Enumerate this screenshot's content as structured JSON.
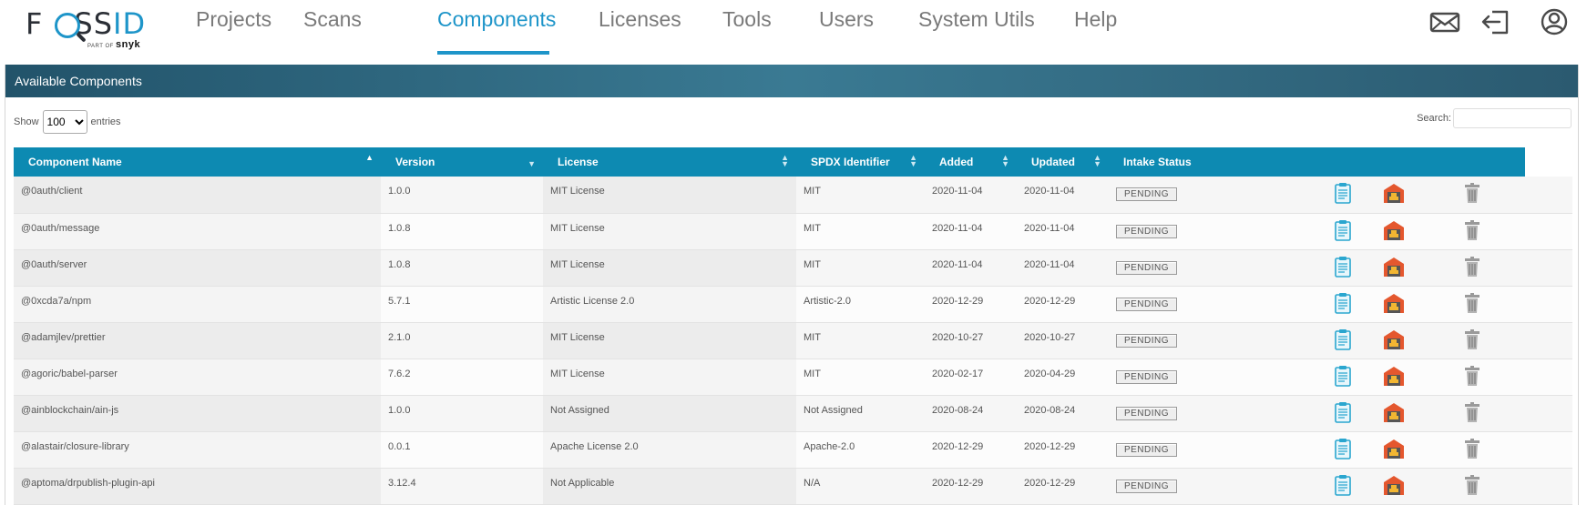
{
  "brand": {
    "logo_main": "F",
    "logo_mid": "SS",
    "logo_id": "ID",
    "part_of": "PART OF",
    "parent": "snyk"
  },
  "nav": [
    {
      "label": "Projects",
      "active": false
    },
    {
      "label": "Scans",
      "active": false
    },
    {
      "label": "Components",
      "active": true
    },
    {
      "label": "Licenses",
      "active": false
    },
    {
      "label": "Tools",
      "active": false
    },
    {
      "label": "Users",
      "active": false
    },
    {
      "label": "System Utils",
      "active": false
    },
    {
      "label": "Help",
      "active": false
    }
  ],
  "top_icons": [
    "mail-icon",
    "logout-icon",
    "user-account-icon"
  ],
  "panel": {
    "title": "Available Components"
  },
  "controls": {
    "show_label": "Show",
    "entries_value": "100",
    "entries_label": "entries",
    "search_label": "Search:",
    "search_value": ""
  },
  "table": {
    "columns": [
      "Component Name",
      "Version",
      "License",
      "SPDX Identifier",
      "Added",
      "Updated",
      "Intake Status"
    ],
    "rows": [
      {
        "name": "@0auth/client",
        "version": "1.0.0",
        "license": "MIT License",
        "spdx": "MIT",
        "added": "2020-11-04",
        "updated": "2020-11-04",
        "status": "PENDING"
      },
      {
        "name": "@0auth/message",
        "version": "1.0.8",
        "license": "MIT License",
        "spdx": "MIT",
        "added": "2020-11-04",
        "updated": "2020-11-04",
        "status": "PENDING"
      },
      {
        "name": "@0auth/server",
        "version": "1.0.8",
        "license": "MIT License",
        "spdx": "MIT",
        "added": "2020-11-04",
        "updated": "2020-11-04",
        "status": "PENDING"
      },
      {
        "name": "@0xcda7a/npm",
        "version": "5.7.1",
        "license": "Artistic License 2.0",
        "spdx": "Artistic-2.0",
        "added": "2020-12-29",
        "updated": "2020-12-29",
        "status": "PENDING"
      },
      {
        "name": "@adamjlev/prettier",
        "version": "2.1.0",
        "license": "MIT License",
        "spdx": "MIT",
        "added": "2020-10-27",
        "updated": "2020-10-27",
        "status": "PENDING"
      },
      {
        "name": "@agoric/babel-parser",
        "version": "7.6.2",
        "license": "MIT License",
        "spdx": "MIT",
        "added": "2020-02-17",
        "updated": "2020-04-29",
        "status": "PENDING"
      },
      {
        "name": "@ainblockchain/ain-js",
        "version": "1.0.0",
        "license": "Not Assigned",
        "spdx": "Not Assigned",
        "added": "2020-08-24",
        "updated": "2020-08-24",
        "status": "PENDING"
      },
      {
        "name": "@alastair/closure-library",
        "version": "0.0.1",
        "license": "Apache License 2.0",
        "spdx": "Apache-2.0",
        "added": "2020-12-29",
        "updated": "2020-12-29",
        "status": "PENDING"
      },
      {
        "name": "@aptoma/drpublish-plugin-api",
        "version": "3.12.4",
        "license": "Not Applicable",
        "spdx": "N/A",
        "added": "2020-12-29",
        "updated": "2020-12-29",
        "status": "PENDING"
      }
    ],
    "row_action_icons": [
      "clipboard-icon",
      "warehouse-icon",
      "trash-icon"
    ]
  },
  "colors": {
    "accent": "#1e95c9",
    "header_bar": "#0d8ab2",
    "panel_header": "#2b5a70"
  }
}
